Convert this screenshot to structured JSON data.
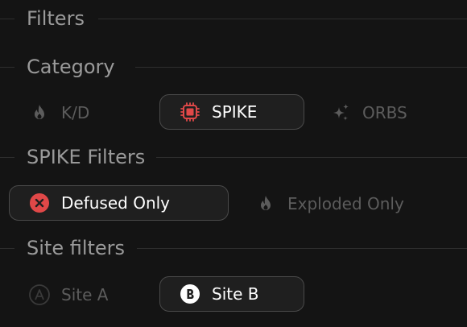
{
  "sections": {
    "filters": {
      "title": "Filters"
    },
    "category": {
      "title": "Category",
      "options": [
        {
          "label": "K/D",
          "icon": "flame-icon",
          "active": false
        },
        {
          "label": "SPIKE",
          "icon": "chip-icon",
          "active": true
        },
        {
          "label": "ORBS",
          "icon": "sparkles-icon",
          "active": false
        }
      ]
    },
    "spike_filters": {
      "title": "SPIKE Filters",
      "options": [
        {
          "label": "Defused Only",
          "icon": "close-circle-icon",
          "active": true
        },
        {
          "label": "Exploded Only",
          "icon": "flame-icon",
          "active": false
        }
      ]
    },
    "site_filters": {
      "title": "Site filters",
      "options": [
        {
          "label": "Site A",
          "icon": "site-a-icon",
          "active": false
        },
        {
          "label": "Site B",
          "icon": "site-b-icon",
          "active": true
        }
      ]
    }
  },
  "colors": {
    "background": "#141414",
    "accent_red": "#e04848",
    "active_text": "#ffffff",
    "inactive_text": "#5c5c5c",
    "header_text": "#9a9a9a"
  }
}
